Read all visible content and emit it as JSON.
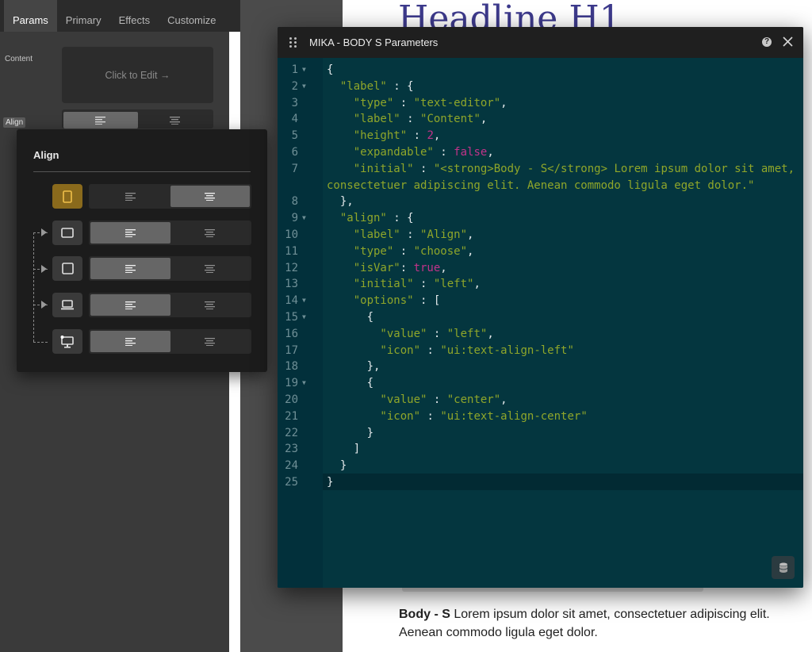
{
  "sidebar": {
    "tabs": [
      {
        "label": "Params",
        "active": true
      },
      {
        "label": "Primary",
        "active": false
      },
      {
        "label": "Effects",
        "active": false
      },
      {
        "label": "Customize",
        "active": false
      }
    ],
    "content_label": "Content",
    "edit_label": "Click to Edit →",
    "align_label": "Align"
  },
  "page": {
    "heading": "Headline H1",
    "body_strong": "Body - S",
    "body_text": " Lorem ipsum dolor sit amet, consectetuer adipiscing elit. Aenean commodo ligula eget dolor."
  },
  "popover": {
    "title": "Align",
    "devices": [
      {
        "icon": "tablet-portrait-icon",
        "selected": "center",
        "active": true
      },
      {
        "icon": "tablet-landscape-icon",
        "selected": "left",
        "active": false
      },
      {
        "icon": "square-icon",
        "selected": "left",
        "active": false
      },
      {
        "icon": "laptop-icon",
        "selected": "left",
        "active": false
      },
      {
        "icon": "desktop-icon",
        "selected": "left",
        "active": false
      }
    ]
  },
  "modal": {
    "title": "MIKA - BODY S Parameters",
    "help": "?",
    "code_lines": [
      {
        "n": "1",
        "fold": true,
        "tokens": [
          [
            "p",
            "{"
          ]
        ]
      },
      {
        "n": "2",
        "fold": true,
        "tokens": [
          [
            "s",
            "  \"label\""
          ],
          [
            "p",
            " : {"
          ]
        ]
      },
      {
        "n": "3",
        "fold": false,
        "tokens": [
          [
            "s",
            "    \"type\""
          ],
          [
            "p",
            " : "
          ],
          [
            "s",
            "\"text-editor\""
          ],
          [
            "p",
            ","
          ]
        ]
      },
      {
        "n": "4",
        "fold": false,
        "tokens": [
          [
            "s",
            "    \"label\""
          ],
          [
            "p",
            " : "
          ],
          [
            "s",
            "\"Content\""
          ],
          [
            "p",
            ","
          ]
        ]
      },
      {
        "n": "5",
        "fold": false,
        "tokens": [
          [
            "s",
            "    \"height\""
          ],
          [
            "p",
            " : "
          ],
          [
            "k",
            "2"
          ],
          [
            "p",
            ","
          ]
        ]
      },
      {
        "n": "6",
        "fold": false,
        "tokens": [
          [
            "s",
            "    \"expandable\""
          ],
          [
            "p",
            " : "
          ],
          [
            "k",
            "false"
          ],
          [
            "p",
            ","
          ]
        ]
      },
      {
        "n": "7",
        "fold": false,
        "tokens": [
          [
            "s",
            "    \"initial\""
          ],
          [
            "p",
            " : "
          ],
          [
            "s",
            "\"<strong>Body - S</strong> Lorem ipsum dolor sit amet,"
          ]
        ]
      },
      {
        "n": "",
        "fold": false,
        "tokens": [
          [
            "s",
            "consectetuer adipiscing elit. Aenean commodo ligula eget dolor.\""
          ]
        ]
      },
      {
        "n": "8",
        "fold": false,
        "tokens": [
          [
            "p",
            "  },"
          ]
        ]
      },
      {
        "n": "9",
        "fold": true,
        "tokens": [
          [
            "s",
            "  \"align\""
          ],
          [
            "p",
            " : {"
          ]
        ]
      },
      {
        "n": "10",
        "fold": false,
        "tokens": [
          [
            "s",
            "    \"label\""
          ],
          [
            "p",
            " : "
          ],
          [
            "s",
            "\"Align\""
          ],
          [
            "p",
            ","
          ]
        ]
      },
      {
        "n": "11",
        "fold": false,
        "tokens": [
          [
            "s",
            "    \"type\""
          ],
          [
            "p",
            " : "
          ],
          [
            "s",
            "\"choose\""
          ],
          [
            "p",
            ","
          ]
        ]
      },
      {
        "n": "12",
        "fold": false,
        "tokens": [
          [
            "s",
            "    \"isVar\""
          ],
          [
            "p",
            ": "
          ],
          [
            "k",
            "true"
          ],
          [
            "p",
            ","
          ]
        ]
      },
      {
        "n": "13",
        "fold": false,
        "tokens": [
          [
            "s",
            "    \"initial\""
          ],
          [
            "p",
            " : "
          ],
          [
            "s",
            "\"left\""
          ],
          [
            "p",
            ","
          ]
        ]
      },
      {
        "n": "14",
        "fold": true,
        "tokens": [
          [
            "s",
            "    \"options\""
          ],
          [
            "p",
            " : ["
          ]
        ]
      },
      {
        "n": "15",
        "fold": true,
        "tokens": [
          [
            "p",
            "      {"
          ]
        ]
      },
      {
        "n": "16",
        "fold": false,
        "tokens": [
          [
            "s",
            "        \"value\""
          ],
          [
            "p",
            " : "
          ],
          [
            "s",
            "\"left\""
          ],
          [
            "p",
            ","
          ]
        ]
      },
      {
        "n": "17",
        "fold": false,
        "tokens": [
          [
            "s",
            "        \"icon\""
          ],
          [
            "p",
            " : "
          ],
          [
            "s",
            "\"ui:text-align-left\""
          ]
        ]
      },
      {
        "n": "18",
        "fold": false,
        "tokens": [
          [
            "p",
            "      },"
          ]
        ]
      },
      {
        "n": "19",
        "fold": true,
        "tokens": [
          [
            "p",
            "      {"
          ]
        ]
      },
      {
        "n": "20",
        "fold": false,
        "tokens": [
          [
            "s",
            "        \"value\""
          ],
          [
            "p",
            " : "
          ],
          [
            "s",
            "\"center\""
          ],
          [
            "p",
            ","
          ]
        ]
      },
      {
        "n": "21",
        "fold": false,
        "tokens": [
          [
            "s",
            "        \"icon\""
          ],
          [
            "p",
            " : "
          ],
          [
            "s",
            "\"ui:text-align-center\""
          ]
        ]
      },
      {
        "n": "22",
        "fold": false,
        "tokens": [
          [
            "p",
            "      }"
          ]
        ]
      },
      {
        "n": "23",
        "fold": false,
        "tokens": [
          [
            "p",
            "    ]"
          ]
        ]
      },
      {
        "n": "24",
        "fold": false,
        "tokens": [
          [
            "p",
            "  }"
          ]
        ]
      },
      {
        "n": "25",
        "fold": false,
        "tokens": [
          [
            "p",
            "}"
          ]
        ]
      }
    ]
  },
  "colors": {
    "editor_bg": "#04363f",
    "string": "#8fa62a",
    "keyword": "#c2338a",
    "heading": "#3d3a8c",
    "active_device": "#8a6a1c"
  }
}
